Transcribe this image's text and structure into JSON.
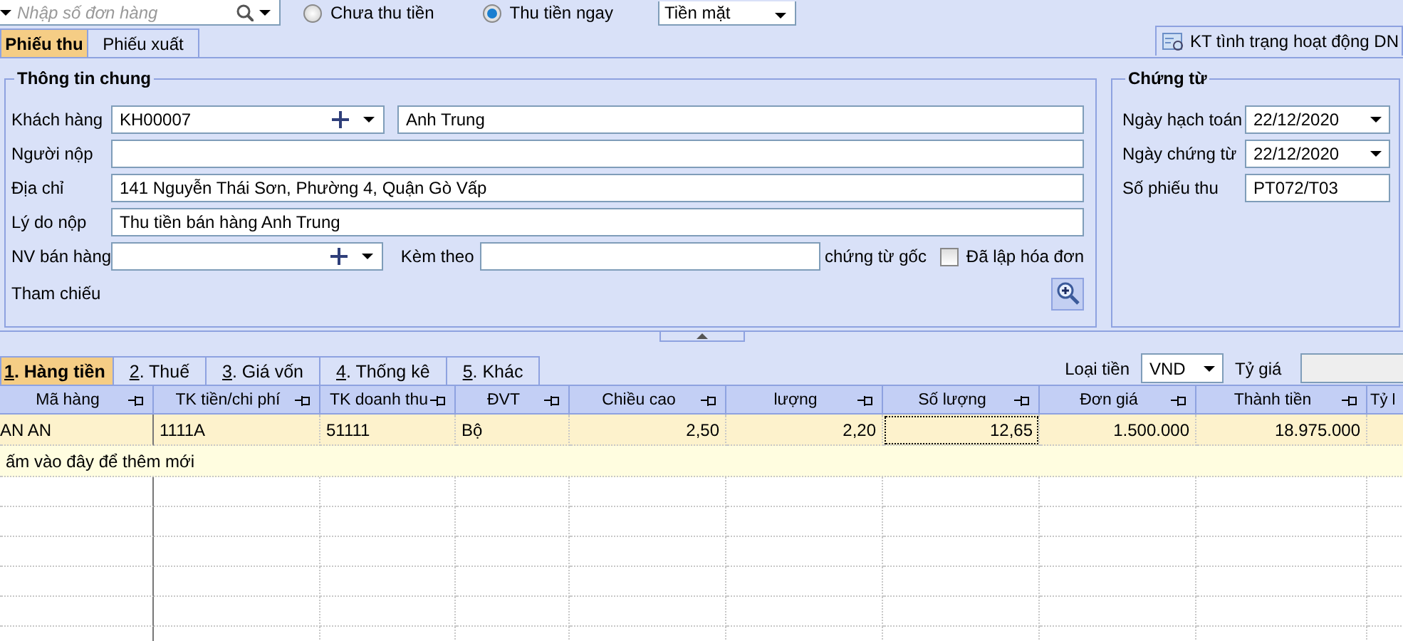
{
  "order_search": {
    "placeholder": "Nhập số đơn hàng"
  },
  "payment_options": [
    {
      "label": "Chưa thu tiền",
      "selected": false
    },
    {
      "label": "Thu tiền ngay",
      "selected": true
    }
  ],
  "payment_method": {
    "value": "Tiền mặt"
  },
  "tabs": [
    {
      "label": "Phiếu thu",
      "selected": true
    },
    {
      "label": "Phiếu xuất",
      "selected": false
    }
  ],
  "status_check_button": {
    "label": "KT tình trạng hoạt động DN"
  },
  "general_info": {
    "title": "Thông tin chung",
    "customer": {
      "label": "Khách hàng",
      "code": "KH00007",
      "name": "Anh Trung"
    },
    "payer": {
      "label": "Người nộp"
    },
    "address": {
      "label": "Địa chỉ",
      "value": "141 Nguyễn Thái Sơn, Phường 4, Quận Gò Vấp"
    },
    "reason": {
      "label": "Lý do nộp",
      "value": "Thu tiền bán hàng Anh Trung"
    },
    "salesperson": {
      "label": "NV bán hàng"
    },
    "attachments": {
      "label": "Kèm theo",
      "suffix": "chứng từ gốc"
    },
    "invoiced": {
      "label": "Đã lập hóa đơn",
      "checked": false
    },
    "reference": {
      "label": "Tham chiếu"
    }
  },
  "voucher": {
    "title": "Chứng từ",
    "fields": [
      {
        "label": "Ngày hạch toán",
        "value": "22/12/2020",
        "kind": "dropdown"
      },
      {
        "label": "Ngày chứng từ",
        "value": "22/12/2020",
        "kind": "dropdown"
      },
      {
        "label": "Số phiếu thu",
        "value": "PT072/T03",
        "kind": "text"
      }
    ]
  },
  "detail_tabs": [
    {
      "label": "1. Hàng tiền",
      "selected": true
    },
    {
      "label": "2. Thuế",
      "selected": false
    },
    {
      "label": "3. Giá vốn",
      "selected": false
    },
    {
      "label": "4. Thống kê",
      "selected": false
    },
    {
      "label": "5. Khác",
      "selected": false
    }
  ],
  "currency": {
    "label": "Loại tiền",
    "value": "VND"
  },
  "exchange_rate": {
    "label": "Tỷ giá",
    "disabled": true
  },
  "table": {
    "columns": [
      {
        "label": "Mã hàng",
        "kind": "text"
      },
      {
        "label": "TK tiền/chi phí",
        "kind": "text"
      },
      {
        "label": "TK doanh thu",
        "kind": "text"
      },
      {
        "label": "ĐVT",
        "kind": "text"
      },
      {
        "label": "Chiều cao",
        "kind": "number"
      },
      {
        "label": "lượng",
        "kind": "number"
      },
      {
        "label": "Số lượng",
        "kind": "number"
      },
      {
        "label": "Đơn giá",
        "kind": "number"
      },
      {
        "label": "Thành tiền",
        "kind": "number"
      },
      {
        "label": "Tỷ l",
        "kind": "number"
      }
    ],
    "rows": [
      {
        "selected": true,
        "cells": [
          {
            "text": "AN AN",
            "focused": false
          },
          {
            "text": "1111A",
            "focused": false
          },
          {
            "text": "51111",
            "focused": false
          },
          {
            "text": "Bộ",
            "focused": false
          },
          {
            "text": "2,50",
            "focused": false
          },
          {
            "text": "2,20",
            "focused": false
          },
          {
            "text": "12,65",
            "focused": true
          },
          {
            "text": "1.500.000",
            "focused": false
          },
          {
            "text": "18.975.000",
            "focused": false
          },
          {
            "text": "",
            "focused": false
          }
        ]
      }
    ],
    "new_row_hint": "ấm vào đây để thêm mới"
  }
}
